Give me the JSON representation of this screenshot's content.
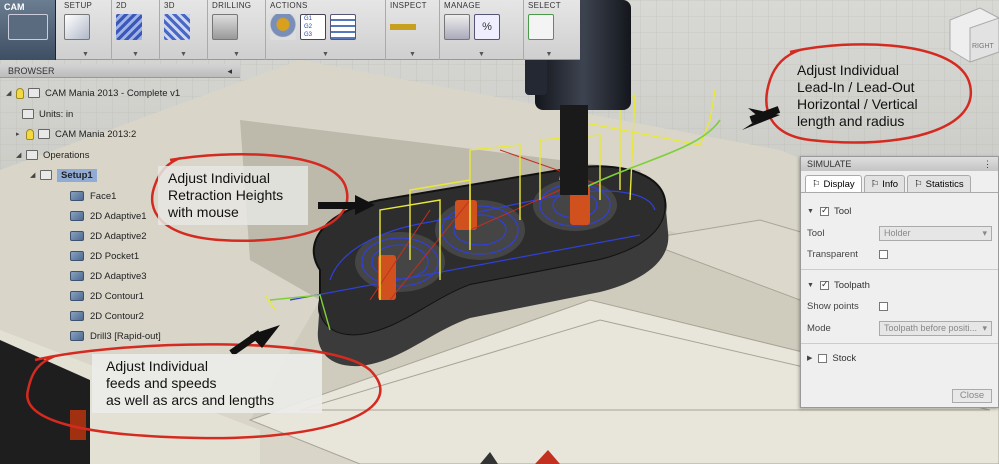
{
  "toolbar": {
    "mode": "CAM",
    "groups": [
      {
        "label": "SETUP"
      },
      {
        "label": "2D"
      },
      {
        "label": "3D"
      },
      {
        "label": "DRILLING"
      },
      {
        "label": "ACTIONS"
      },
      {
        "label": "INSPECT"
      },
      {
        "label": "MANAGE"
      },
      {
        "label": "SELECT"
      }
    ],
    "gcode_icon_lines": [
      "G1",
      "G2",
      "G3"
    ],
    "manage_icon_text": "%"
  },
  "viewcube": {
    "right_label": "RIGHT"
  },
  "browser": {
    "header": "BROWSER",
    "items": [
      {
        "label": "CAM Mania 2013 - Complete v1"
      },
      {
        "label": "Units: in"
      },
      {
        "label": "CAM Mania 2013:2"
      },
      {
        "label": "Operations"
      },
      {
        "label": "Setup1"
      },
      {
        "label": "Face1"
      },
      {
        "label": "2D Adaptive1"
      },
      {
        "label": "2D Adaptive2"
      },
      {
        "label": "2D Pocket1"
      },
      {
        "label": "2D Adaptive3"
      },
      {
        "label": "2D Contour1"
      },
      {
        "label": "2D Contour2"
      },
      {
        "label": "Drill3 [Rapid-out]"
      }
    ]
  },
  "simulate": {
    "title": "SIMULATE",
    "tabs": [
      "Display",
      "Info",
      "Statistics"
    ],
    "tool_section": "Tool",
    "tool_label": "Tool",
    "tool_value": "Holder",
    "transparent_label": "Transparent",
    "toolpath_section": "Toolpath",
    "show_points_label": "Show points",
    "mode_label": "Mode",
    "mode_value": "Toolpath before positi...",
    "stock_section": "Stock",
    "close": "Close"
  },
  "annotations": {
    "leadin": [
      "Adjust Individual",
      "Lead-In / Lead-Out",
      "Horizontal / Vertical",
      "length and radius"
    ],
    "retraction": [
      "Adjust Individual",
      "Retraction Heights",
      "with mouse"
    ],
    "feeds": [
      "Adjust Individual",
      "feeds and speeds",
      "as well as arcs and lengths"
    ]
  },
  "colors": {
    "annotation_circle": "#d42a20",
    "toolpath_yellow": "#e8e83a",
    "toolpath_blue": "#3040d8",
    "part_dark": "#2a2a2a"
  }
}
